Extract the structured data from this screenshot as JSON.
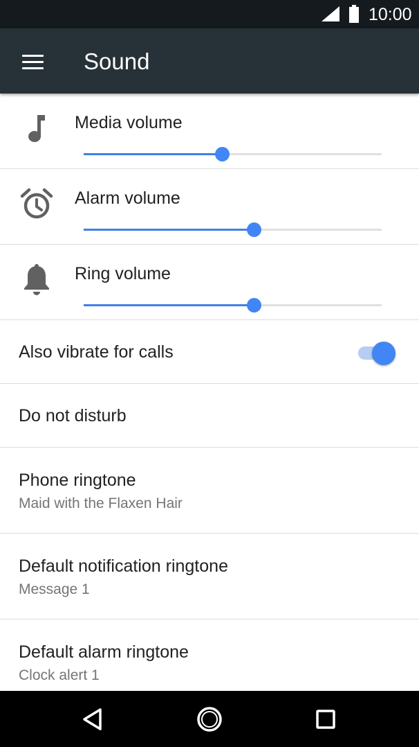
{
  "status_bar": {
    "time": "10:00",
    "icons": [
      "cell-signal-icon",
      "battery-icon"
    ]
  },
  "app_bar": {
    "menu_icon": "hamburger-menu-icon",
    "title": "Sound"
  },
  "volume_sliders": [
    {
      "icon": "music-note-icon",
      "label": "Media volume",
      "level": 0.465
    },
    {
      "icon": "alarm-clock-icon",
      "label": "Alarm volume",
      "level": 0.57
    },
    {
      "icon": "bell-icon",
      "label": "Ring volume",
      "level": 0.57
    }
  ],
  "vibrate": {
    "label": "Also vibrate for calls",
    "enabled": true
  },
  "dnd": {
    "label": "Do not disturb"
  },
  "phone_ringtone": {
    "label": "Phone ringtone",
    "value": "Maid with the Flaxen Hair"
  },
  "notification_ringtone": {
    "label": "Default notification ringtone",
    "value": "Message 1"
  },
  "alarm_ringtone": {
    "label": "Default alarm ringtone",
    "value": "Clock alert 1"
  },
  "nav_bar": {
    "icons": [
      "back-icon",
      "home-icon",
      "recents-icon"
    ]
  },
  "colors": {
    "accent": "#4285f4",
    "app_bar": "#273238",
    "status_bar": "#151a1e",
    "secondary_text": "#757575"
  }
}
